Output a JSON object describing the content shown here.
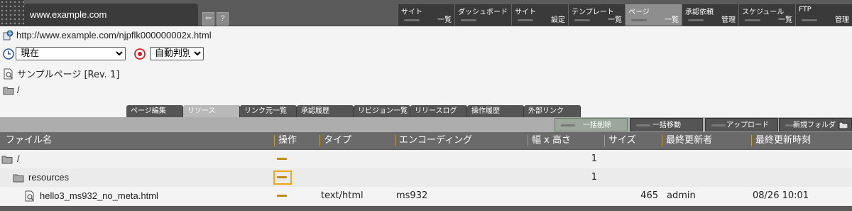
{
  "topbar": {
    "site_name": "www.example.com",
    "menus": [
      {
        "line1": "サイト",
        "line2": "一覧"
      },
      {
        "line1": "ダッシュボード",
        "line2": ""
      },
      {
        "line1": "サイト",
        "line2": "設定"
      },
      {
        "line1": "テンプレート",
        "line2": "一覧"
      },
      {
        "line1": "ページ",
        "line2": "一覧",
        "active": true
      },
      {
        "line1": "承認依頼",
        "line2": "管理"
      },
      {
        "line1": "スケジュール",
        "line2": "一覧"
      },
      {
        "line1": "FTP",
        "line2": "管理"
      }
    ]
  },
  "info": {
    "url": "http://www.example.com/njpflk000000002x.html",
    "time_select": "現在",
    "auto_select": "自動判別",
    "page_name": "サンプルページ [Rev. 1]",
    "path": "/"
  },
  "subtabs": [
    {
      "label": "ページ編集"
    },
    {
      "label": "リソース",
      "active": true
    },
    {
      "label": "リンク元一覧"
    },
    {
      "label": "承認履歴"
    },
    {
      "label": "リビジョン一覧"
    },
    {
      "label": "リリースログ"
    },
    {
      "label": "操作履歴"
    },
    {
      "label": "外部リンク"
    }
  ],
  "actions": [
    {
      "label": "一括削除",
      "active": true
    },
    {
      "label": "一括移動"
    },
    {
      "label": "アップロード"
    },
    {
      "label": "新規フォルダ"
    }
  ],
  "table": {
    "headers": [
      "ファイル名",
      "操作",
      "タイプ",
      "エンコーディング",
      "幅 x 高さ",
      "サイズ",
      "最終更新者",
      "最終更新時刻"
    ],
    "rows": [
      {
        "name": "/",
        "type": "",
        "encoding": "",
        "dims": "1",
        "size": "",
        "updater": "",
        "updated": ""
      },
      {
        "name": "resources",
        "type": "",
        "encoding": "",
        "dims": "1",
        "size": "",
        "updater": "",
        "updated": ""
      },
      {
        "name": "hello3_ms932_no_meta.html",
        "type": "text/html",
        "encoding": "ms932",
        "dims": "",
        "size": "465",
        "updater": "admin",
        "updated": "08/26 10:01"
      }
    ]
  }
}
